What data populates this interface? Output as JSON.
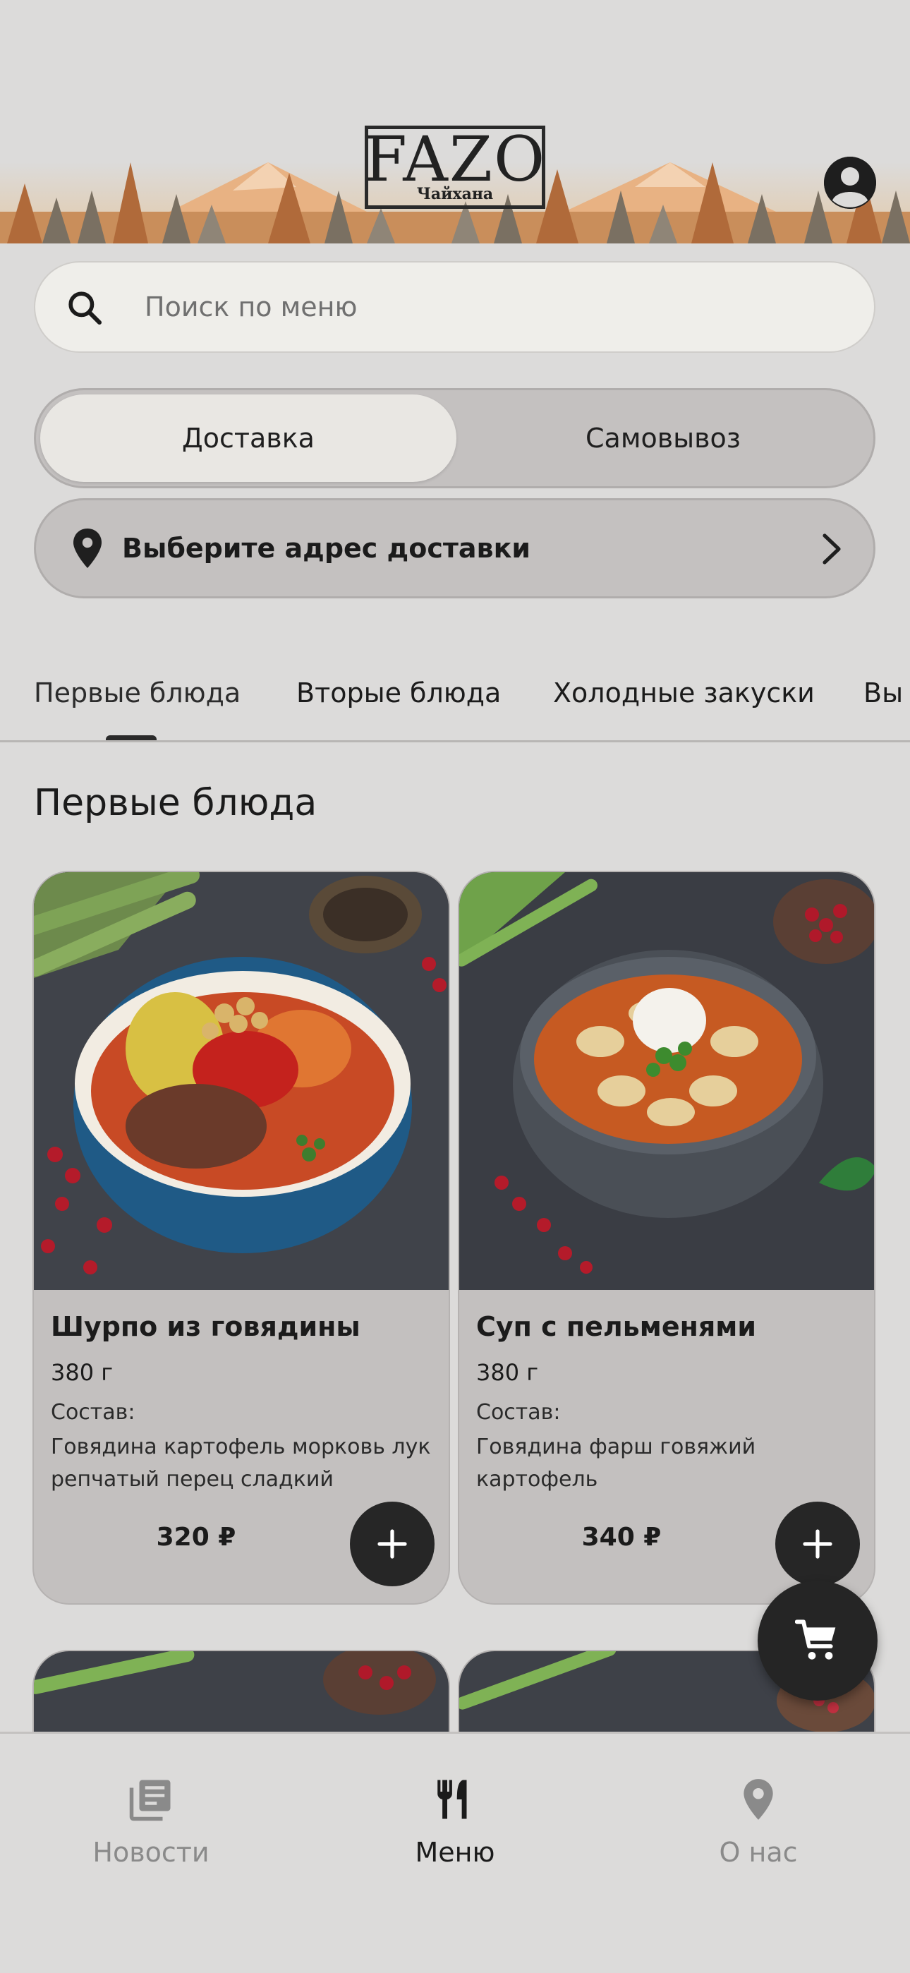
{
  "header": {
    "brand": "FAZO",
    "brand_sub": "Чайхана"
  },
  "search": {
    "placeholder": "Поиск по меню"
  },
  "delivery_toggle": {
    "options": [
      "Доставка",
      "Самовывоз"
    ],
    "selected": "Доставка"
  },
  "address": {
    "label": "Выберите адрес доставки"
  },
  "tabs": [
    {
      "label": "Первые блюда",
      "active": true
    },
    {
      "label": "Вторые блюда",
      "active": false
    },
    {
      "label": "Холодные закуски",
      "active": false
    },
    {
      "label": "Вы",
      "active": false
    }
  ],
  "section_title": "Первые блюда",
  "products": [
    {
      "name": "Шурпо из говядины",
      "weight": "380 г",
      "composition_label": "Состав:",
      "composition": "Говядина картофель морковь лук репчатый перец сладкий",
      "price": "320 ₽"
    },
    {
      "name": "Суп с пельменями",
      "weight": "380 г",
      "composition_label": "Состав:",
      "composition": "Говядина фарш говяжий картофель",
      "price": "340 ₽"
    }
  ],
  "bottom_nav": [
    {
      "label": "Новости",
      "icon": "news-icon",
      "active": false
    },
    {
      "label": "Меню",
      "icon": "menu-utensils-icon",
      "active": true
    },
    {
      "label": "О нас",
      "icon": "location-pin-icon",
      "active": false
    }
  ],
  "colors": {
    "background": "#dcdbda",
    "card": "#c3c0bf",
    "accent_dark": "#262626"
  }
}
